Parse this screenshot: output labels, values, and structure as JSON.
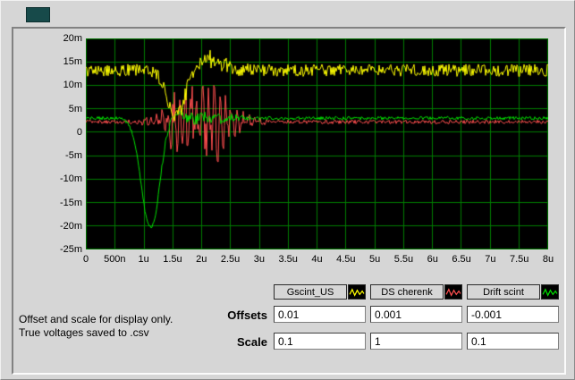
{
  "window": {
    "bg_color": "#d6d6d6"
  },
  "decoration": {
    "color": "#174a4a"
  },
  "note": {
    "line1": "Offset and scale for display only.",
    "line2": "True voltages saved to .csv"
  },
  "controls": {
    "offsets_label": "Offsets",
    "scale_label": "Scale",
    "offsets_values": [
      "0.01",
      "0.001",
      "-0.001"
    ],
    "scale_values": [
      "0.1",
      "1",
      "0.1"
    ]
  },
  "legend": {
    "items": [
      {
        "label": "Gscint_US",
        "color": "#ffff00"
      },
      {
        "label": "DS cherenk",
        "color": "#ff4f4f"
      },
      {
        "label": "Drift scint",
        "color": "#00e000"
      }
    ]
  },
  "chart_data": {
    "type": "line",
    "title": "",
    "plot_bg": "#000000",
    "grid_color": "#007d00",
    "grid": true,
    "legend_position": "below-right",
    "x_axis": {
      "min_u": 0,
      "max_u": 8,
      "unit": "seconds (n = nano, u = micro)",
      "ticks": [
        "0",
        "500n",
        "1u",
        "1.5u",
        "2u",
        "2.5u",
        "3u",
        "3.5u",
        "4u",
        "4.5u",
        "5u",
        "5.5u",
        "6u",
        "6.5u",
        "7u",
        "7.5u",
        "8u"
      ]
    },
    "y_axis": {
      "min_m": -25,
      "max_m": 20,
      "unit": "volts (m = milli)",
      "ticks": [
        "20m",
        "15m",
        "10m",
        "5m",
        "0",
        "-5m",
        "-10m",
        "-15m",
        "-20m",
        "-25m"
      ]
    },
    "draw_order": [
      1,
      2,
      0
    ],
    "series": [
      {
        "name": "Gscint_US",
        "color": "#ffff00",
        "baseline_m": 13.2,
        "noise_m": 1.3,
        "events": [
          {
            "type": "gauss",
            "center_u": 1.55,
            "width_u": 0.15,
            "amp_m": -9.5
          },
          {
            "type": "gauss",
            "center_u": 2.15,
            "width_u": 0.2,
            "amp_m": 2.5
          },
          {
            "type": "noise",
            "center_u": 2.0,
            "width_u": 0.35,
            "amp_m": 1.6
          }
        ]
      },
      {
        "name": "DS cherenk",
        "color": "#ff4f4f",
        "baseline_m": 2.2,
        "noise_m": 0.4,
        "events": [
          {
            "type": "ring",
            "center_u": 2.0,
            "width_u": 0.42,
            "freq_per_u": 10,
            "amp_m": 6.5
          },
          {
            "type": "noise",
            "center_u": 2.0,
            "width_u": 0.45,
            "amp_m": 4
          }
        ]
      },
      {
        "name": "Drift scint",
        "color": "#00e000",
        "baseline_m": 3.0,
        "noise_m": 0.35,
        "events": [
          {
            "type": "gauss",
            "center_u": 1.12,
            "width_u": 0.16,
            "amp_m": -23.5
          },
          {
            "type": "gauss",
            "center_u": 1.5,
            "width_u": 0.12,
            "amp_m": 1.4
          },
          {
            "type": "noise",
            "center_u": 2.0,
            "width_u": 0.5,
            "amp_m": 1.2
          }
        ]
      }
    ]
  }
}
